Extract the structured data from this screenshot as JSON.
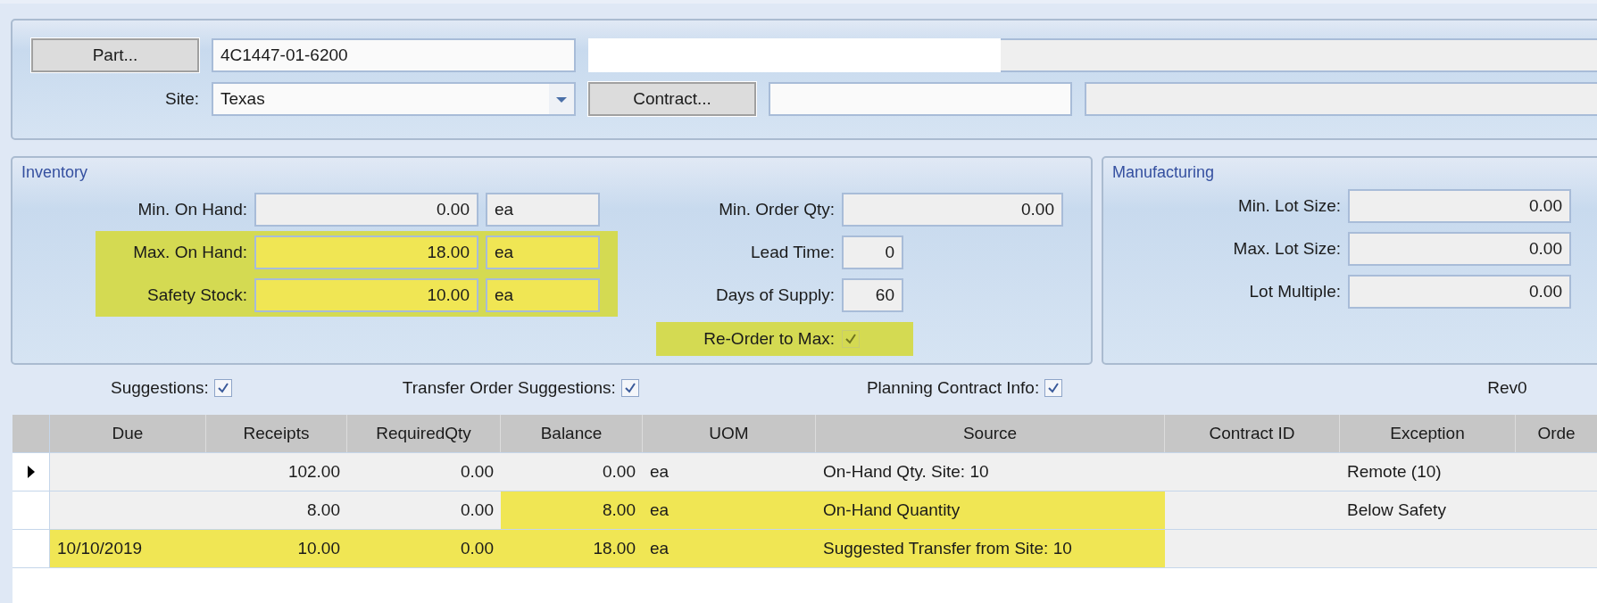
{
  "part": {
    "button": "Part...",
    "value": "4C1447-01-6200"
  },
  "site": {
    "label": "Site:",
    "value": "Texas"
  },
  "contract": {
    "button": "Contract..."
  },
  "inventory": {
    "title": "Inventory",
    "fields": [
      {
        "label": "Min. On Hand:",
        "value": "0.00",
        "uom": "ea",
        "highlighted": false
      },
      {
        "label": "Max. On Hand:",
        "value": "18.00",
        "uom": "ea",
        "highlighted": true
      },
      {
        "label": "Safety Stock:",
        "value": "10.00",
        "uom": "ea",
        "highlighted": true
      }
    ],
    "order_fields": [
      {
        "label": "Min. Order Qty:",
        "value": "0.00",
        "kind": "wide"
      },
      {
        "label": "Lead Time:",
        "value": "0",
        "kind": "narrow"
      },
      {
        "label": "Days of Supply:",
        "value": "60",
        "kind": "narrow"
      }
    ],
    "reorder": {
      "label": "Re-Order to Max:",
      "checked": true,
      "disabled": true,
      "highlighted": true
    }
  },
  "manufacturing": {
    "title": "Manufacturing",
    "fields": [
      {
        "label": "Min. Lot Size:",
        "value": "0.00"
      },
      {
        "label": "Max. Lot Size:",
        "value": "0.00"
      },
      {
        "label": "Lot Multiple:",
        "value": "0.00"
      }
    ]
  },
  "options": [
    {
      "label": "Suggestions:",
      "checked": true
    },
    {
      "label": "Transfer Order Suggestions:",
      "checked": true
    },
    {
      "label": "Planning Contract Info:",
      "checked": true
    }
  ],
  "revision": "Rev0",
  "grid": {
    "columns": [
      "Due",
      "Receipts",
      "RequiredQty",
      "Balance",
      "UOM",
      "Source",
      "Contract ID",
      "Exception",
      "Orde"
    ],
    "rows": [
      {
        "selected": true,
        "cells": [
          {
            "highlighted": false
          },
          {
            "text": "102.00",
            "highlighted": false
          },
          {
            "text": "0.00",
            "highlighted": false
          },
          {
            "text": "0.00",
            "highlighted": false
          },
          {
            "text": "ea",
            "highlighted": false
          },
          {
            "text": "On-Hand Qty. Site: 10",
            "highlighted": false
          },
          {
            "highlighted": false
          },
          {
            "text": "Remote (10)",
            "highlighted": false
          },
          {
            "highlighted": false
          }
        ]
      },
      {
        "selected": false,
        "cells": [
          {
            "highlighted": false
          },
          {
            "text": "8.00",
            "highlighted": false
          },
          {
            "text": "0.00",
            "highlighted": false
          },
          {
            "text": "8.00",
            "highlighted": true
          },
          {
            "text": "ea",
            "highlighted": true
          },
          {
            "text": "On-Hand Quantity",
            "highlighted": true
          },
          {
            "highlighted": false
          },
          {
            "text": "Below Safety",
            "highlighted": false
          },
          {
            "highlighted": false
          }
        ]
      },
      {
        "selected": false,
        "cells": [
          {
            "text": "10/10/2019",
            "highlighted": true
          },
          {
            "text": "10.00",
            "highlighted": true
          },
          {
            "text": "0.00",
            "highlighted": true
          },
          {
            "text": "18.00",
            "highlighted": true
          },
          {
            "text": "ea",
            "highlighted": true
          },
          {
            "text": "Suggested Transfer from Site: 10",
            "highlighted": true
          },
          {
            "highlighted": false
          },
          {
            "highlighted": false
          },
          {
            "highlighted": false
          }
        ]
      }
    ]
  }
}
